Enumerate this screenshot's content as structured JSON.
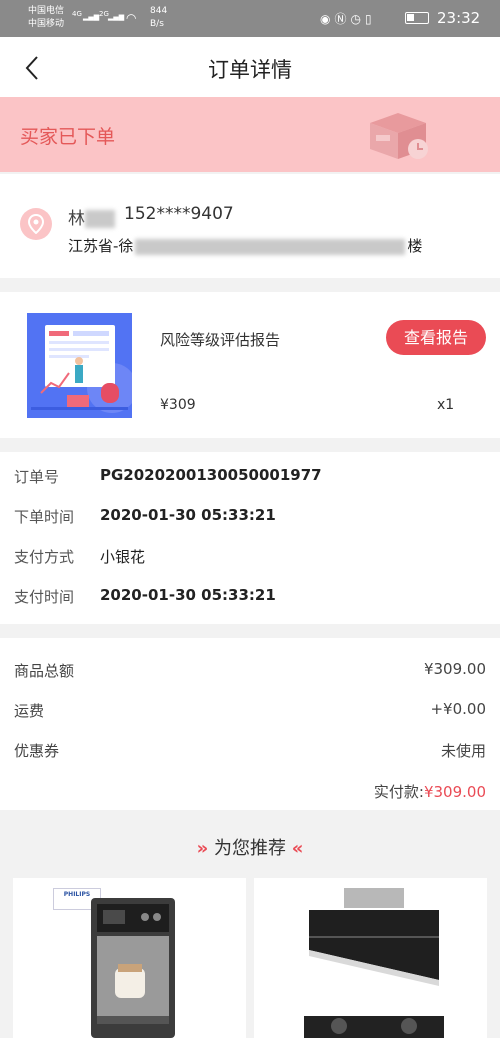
{
  "status_bar": {
    "carrier1": "中国电信",
    "carrier2": "中国移动",
    "sig1": "4G",
    "sig2": "2G",
    "speed_value": "844",
    "speed_unit": "B/s",
    "time": "23:32",
    "icons": [
      "eye-icon",
      "nfc-icon",
      "alarm-icon",
      "vibrate-icon",
      "battery-icon"
    ]
  },
  "header": {
    "title": "订单详情",
    "back_icon": "chevron-left-icon"
  },
  "order_status": {
    "text": "买家已下单",
    "icon": "package-clock-icon"
  },
  "address": {
    "name": "林",
    "phone": "152****9407",
    "line_start": "江苏省-徐",
    "line_end": "楼",
    "icon": "location-pin-icon"
  },
  "product": {
    "name": "风险等级评估报告",
    "button": "查看报告",
    "price": "¥309",
    "qty": "x1"
  },
  "order_info": [
    {
      "label": "订单号",
      "value": "PG2020200130050001977"
    },
    {
      "label": "下单时间",
      "value": "2020-01-30 05:33:21"
    },
    {
      "label": "支付方式",
      "value": "小银花"
    },
    {
      "label": "支付时间",
      "value": "2020-01-30 05:33:21"
    }
  ],
  "totals": [
    {
      "label": "商品总额",
      "value": "¥309.00"
    },
    {
      "label": "运费",
      "value": "+¥0.00"
    },
    {
      "label": "优惠券",
      "value": "未使用"
    }
  ],
  "paid": {
    "label": "实付款:",
    "amount": "¥309.00"
  },
  "recommend": {
    "title": "为您推荐",
    "left_icon": "double-chevron-right-icon",
    "right_icon": "double-chevron-left-icon",
    "brand": "PHILIPS"
  },
  "colors": {
    "accent": "#ea4b55",
    "banner_bg": "#fbc4c6",
    "banner_text": "#e45858"
  }
}
